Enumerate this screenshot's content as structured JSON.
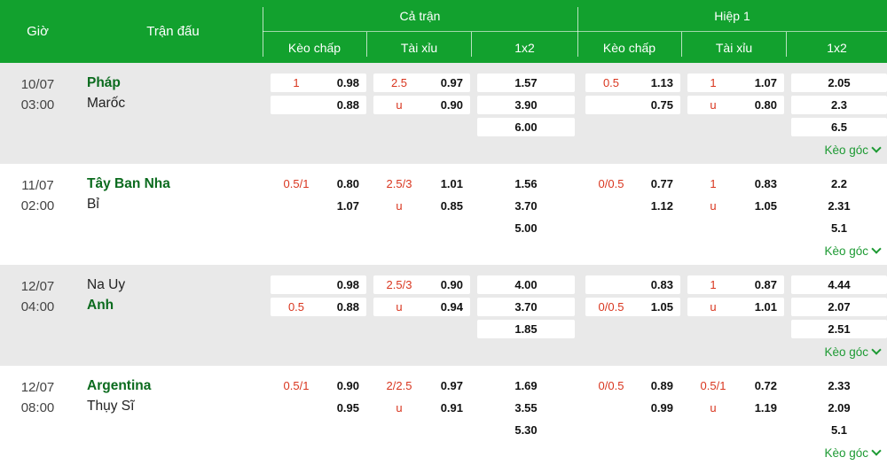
{
  "header": {
    "time_label": "Giờ",
    "match_label": "Trận đấu",
    "full_match": {
      "title": "Cả trận",
      "cols": [
        "Kèo chấp",
        "Tài xỉu",
        "1x2"
      ]
    },
    "first_half": {
      "title": "Hiệp 1",
      "cols": [
        "Kèo chấp",
        "Tài xỉu",
        "1x2"
      ]
    }
  },
  "corner_label": "Kèo góc",
  "colors": {
    "header_bg": "#12a12e",
    "favorite_team": "#0b6b1e",
    "handicap_line": "#d9361f",
    "row_shade": "#e9e9e9"
  },
  "matches": [
    {
      "date": "10/07",
      "time": "03:00",
      "home": "Pháp",
      "away": "Marốc",
      "favorite": "home",
      "ft": {
        "hdp": [
          {
            "line": "1",
            "odds": "0.98"
          },
          {
            "line": "",
            "odds": "0.88"
          }
        ],
        "ou": [
          {
            "line": "2.5",
            "odds": "0.97"
          },
          {
            "line": "u",
            "odds": "0.90"
          }
        ],
        "x12": [
          "1.57",
          "3.90",
          "6.00"
        ]
      },
      "ht": {
        "hdp": [
          {
            "line": "0.5",
            "odds": "1.13"
          },
          {
            "line": "",
            "odds": "0.75"
          }
        ],
        "ou": [
          {
            "line": "1",
            "odds": "1.07"
          },
          {
            "line": "u",
            "odds": "0.80"
          }
        ],
        "x12": [
          "2.05",
          "2.3",
          "6.5"
        ]
      }
    },
    {
      "date": "11/07",
      "time": "02:00",
      "home": "Tây Ban Nha",
      "away": "Bỉ",
      "favorite": "home",
      "ft": {
        "hdp": [
          {
            "line": "0.5/1",
            "odds": "0.80"
          },
          {
            "line": "",
            "odds": "1.07"
          }
        ],
        "ou": [
          {
            "line": "2.5/3",
            "odds": "1.01"
          },
          {
            "line": "u",
            "odds": "0.85"
          }
        ],
        "x12": [
          "1.56",
          "3.70",
          "5.00"
        ]
      },
      "ht": {
        "hdp": [
          {
            "line": "0/0.5",
            "odds": "0.77"
          },
          {
            "line": "",
            "odds": "1.12"
          }
        ],
        "ou": [
          {
            "line": "1",
            "odds": "0.83"
          },
          {
            "line": "u",
            "odds": "1.05"
          }
        ],
        "x12": [
          "2.2",
          "2.31",
          "5.1"
        ]
      }
    },
    {
      "date": "12/07",
      "time": "04:00",
      "home": "Na Uy",
      "away": "Anh",
      "favorite": "away",
      "ft": {
        "hdp": [
          {
            "line": "",
            "odds": "0.98"
          },
          {
            "line": "0.5",
            "odds": "0.88"
          }
        ],
        "ou": [
          {
            "line": "2.5/3",
            "odds": "0.90"
          },
          {
            "line": "u",
            "odds": "0.94"
          }
        ],
        "x12": [
          "4.00",
          "3.70",
          "1.85"
        ]
      },
      "ht": {
        "hdp": [
          {
            "line": "",
            "odds": "0.83"
          },
          {
            "line": "0/0.5",
            "odds": "1.05"
          }
        ],
        "ou": [
          {
            "line": "1",
            "odds": "0.87"
          },
          {
            "line": "u",
            "odds": "1.01"
          }
        ],
        "x12": [
          "4.44",
          "2.07",
          "2.51"
        ]
      }
    },
    {
      "date": "12/07",
      "time": "08:00",
      "home": "Argentina",
      "away": "Thụy Sĩ",
      "favorite": "home",
      "ft": {
        "hdp": [
          {
            "line": "0.5/1",
            "odds": "0.90"
          },
          {
            "line": "",
            "odds": "0.95"
          }
        ],
        "ou": [
          {
            "line": "2/2.5",
            "odds": "0.97"
          },
          {
            "line": "u",
            "odds": "0.91"
          }
        ],
        "x12": [
          "1.69",
          "3.55",
          "5.30"
        ]
      },
      "ht": {
        "hdp": [
          {
            "line": "0/0.5",
            "odds": "0.89"
          },
          {
            "line": "",
            "odds": "0.99"
          }
        ],
        "ou": [
          {
            "line": "0.5/1",
            "odds": "0.72"
          },
          {
            "line": "u",
            "odds": "1.19"
          }
        ],
        "x12": [
          "2.33",
          "2.09",
          "5.1"
        ]
      }
    }
  ]
}
